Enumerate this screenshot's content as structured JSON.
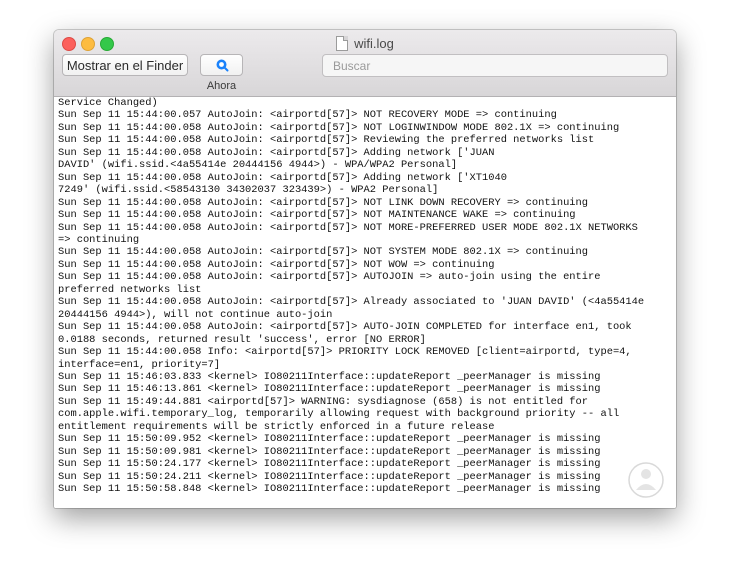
{
  "window": {
    "title": "wifi.log"
  },
  "toolbar": {
    "finder_button_label": "Mostrar en el Finder",
    "now_button_label": "Ahora",
    "search_placeholder": "Buscar"
  },
  "icons": {
    "now_button": "clock-refresh-icon",
    "title": "document-icon"
  },
  "colors": {
    "close": "#fc605c",
    "minimize": "#fdbc40",
    "maximize": "#34c84a",
    "now_icon": "#1a82fb"
  },
  "log_lines": [
    "Service Changed)",
    "Sun Sep 11 15:44:00.057 AutoJoin: <airportd[57]> NOT RECOVERY MODE => continuing",
    "Sun Sep 11 15:44:00.058 AutoJoin: <airportd[57]> NOT LOGINWINDOW MODE 802.1X => continuing",
    "Sun Sep 11 15:44:00.058 AutoJoin: <airportd[57]> Reviewing the preferred networks list",
    "Sun Sep 11 15:44:00.058 AutoJoin: <airportd[57]> Adding network ['JUAN",
    "DAVID' (wifi.ssid.<4a55414e 20444156 4944>) - WPA/WPA2 Personal]",
    "Sun Sep 11 15:44:00.058 AutoJoin: <airportd[57]> Adding network ['XT1040",
    "7249' (wifi.ssid.<58543130 34302037 323439>) - WPA2 Personal]",
    "Sun Sep 11 15:44:00.058 AutoJoin: <airportd[57]> NOT LINK DOWN RECOVERY => continuing",
    "Sun Sep 11 15:44:00.058 AutoJoin: <airportd[57]> NOT MAINTENANCE WAKE => continuing",
    "Sun Sep 11 15:44:00.058 AutoJoin: <airportd[57]> NOT MORE-PREFERRED USER MODE 802.1X NETWORKS",
    "=> continuing",
    "Sun Sep 11 15:44:00.058 AutoJoin: <airportd[57]> NOT SYSTEM MODE 802.1X => continuing",
    "Sun Sep 11 15:44:00.058 AutoJoin: <airportd[57]> NOT WOW => continuing",
    "Sun Sep 11 15:44:00.058 AutoJoin: <airportd[57]> AUTOJOIN => auto-join using the entire",
    "preferred networks list",
    "Sun Sep 11 15:44:00.058 AutoJoin: <airportd[57]> Already associated to 'JUAN DAVID' (<4a55414e",
    "20444156 4944>), will not continue auto-join",
    "Sun Sep 11 15:44:00.058 AutoJoin: <airportd[57]> AUTO-JOIN COMPLETED for interface en1, took",
    "0.0188 seconds, returned result 'success', error [NO ERROR]",
    "Sun Sep 11 15:44:00.058 Info: <airportd[57]> PRIORITY LOCK REMOVED [client=airportd, type=4,",
    "interface=en1, priority=7]",
    "Sun Sep 11 15:46:03.833 <kernel> IO80211Interface::updateReport _peerManager is missing",
    "Sun Sep 11 15:46:13.861 <kernel> IO80211Interface::updateReport _peerManager is missing",
    "Sun Sep 11 15:49:44.881 <airportd[57]> WARNING: sysdiagnose (658) is not entitled for",
    "com.apple.wifi.temporary_log, temporarily allowing request with background priority -- all",
    "entitlement requirements will be strictly enforced in a future release",
    "Sun Sep 11 15:50:09.952 <kernel> IO80211Interface::updateReport _peerManager is missing",
    "Sun Sep 11 15:50:09.981 <kernel> IO80211Interface::updateReport _peerManager is missing",
    "Sun Sep 11 15:50:24.177 <kernel> IO80211Interface::updateReport _peerManager is missing",
    "Sun Sep 11 15:50:24.211 <kernel> IO80211Interface::updateReport _peerManager is missing",
    "Sun Sep 11 15:50:58.848 <kernel> IO80211Interface::updateReport _peerManager is missing"
  ]
}
